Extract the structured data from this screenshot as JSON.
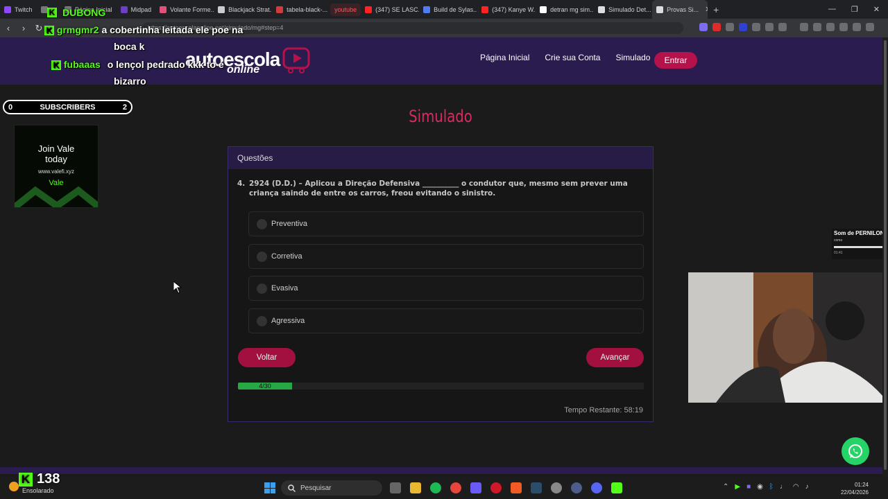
{
  "browser": {
    "tabs": [
      {
        "label": "Twitch",
        "color": "#9147ff"
      },
      {
        "label": "...",
        "color": "#777777"
      },
      {
        "label": "Página Inicial",
        "color": "#777777"
      },
      {
        "label": "Midpad",
        "color": "#6c3fc5"
      },
      {
        "label": "Volante Forme...",
        "color": "#e0527a"
      },
      {
        "label": "Blackjack Strat...",
        "color": "#cccccc"
      },
      {
        "label": "tabela-black-...",
        "color": "#d23b3b"
      },
      {
        "label": "youtube",
        "color": "#ff3333"
      },
      {
        "label": "(347) SE LASC...",
        "color": "#ff2222"
      },
      {
        "label": "Build de Sylas...",
        "color": "#4f7cf0"
      },
      {
        "label": "(347) Kanye W...",
        "color": "#ff2222"
      },
      {
        "label": "detran mg sim...",
        "color": "#ffffff"
      },
      {
        "label": "Simulado Det...",
        "color": "#dddddd"
      },
      {
        "label": "Provas Si...",
        "color": "#dddddd"
      }
    ],
    "url": "https://autoescolaonline.net/simulado/mg#step=4"
  },
  "site": {
    "logo_text": "autoescola",
    "logo_sub": "online",
    "nav": {
      "home": "Página Inicial",
      "signup": "Crie sua Conta",
      "quiz": "Simulado",
      "login": "Entrar"
    },
    "page_title": "Simulado",
    "card_header": "Questões",
    "question": {
      "number": "4.",
      "text": "2924 (D.D.) – Aplicou a Direção Defensiva __________ o condutor que, mesmo sem prever uma criança saindo de entre os carros, freou evitando o sinistro."
    },
    "options": [
      "Preventiva",
      "Corretiva",
      "Evasiva",
      "Agressiva"
    ],
    "back_button": "Voltar",
    "next_button": "Avançar",
    "progress": {
      "label": "4/30",
      "current": 4,
      "total": 30
    },
    "timer": "Tempo Restante: 58:19"
  },
  "overlay": {
    "top_user": "DUBONG",
    "chat": [
      {
        "user": "grmgmr2",
        "message": "a cobertinha leitada ele poe na"
      },
      {
        "user": "",
        "message": "boca k"
      },
      {
        "user": "fubaaas",
        "message": "o lençol pedrado kkk to é"
      },
      {
        "user": "",
        "message": "bizarro"
      }
    ],
    "subs": {
      "left": "0",
      "label": "SUBSCRIBERS",
      "right": "2"
    },
    "ad": {
      "line1": "Join Vale",
      "line2": "today",
      "site": "www.valefi.xyz",
      "brand": "Vale"
    },
    "song": {
      "title": "Som de PERNILONGO",
      "artist": "como",
      "time": "01:41"
    },
    "kick_count": "138"
  },
  "taskbar": {
    "weather": "Ensolarado",
    "search": "Pesquisar",
    "time": "01:24",
    "date": "22/04/2026"
  }
}
